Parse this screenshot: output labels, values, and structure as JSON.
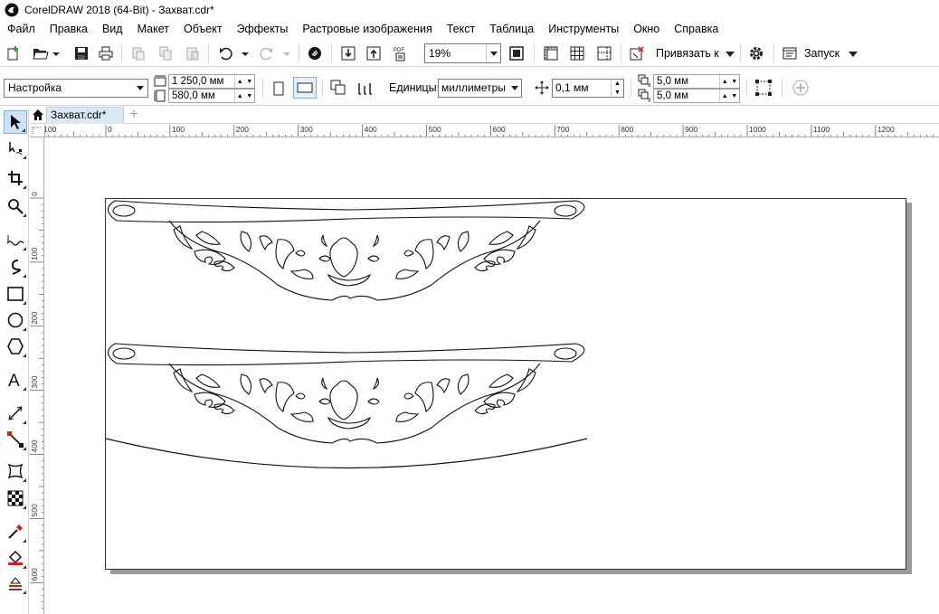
{
  "window": {
    "title": "CorelDRAW 2018 (64-Bit) - Захват.cdr*"
  },
  "menu": {
    "items": [
      "Файл",
      "Правка",
      "Вид",
      "Макет",
      "Объект",
      "Эффекты",
      "Растровые изображения",
      "Текст",
      "Таблица",
      "Инструменты",
      "Окно",
      "Справка"
    ]
  },
  "toolbar": {
    "zoom_value": "19%",
    "snap_label": "Привязать к",
    "launch_label": "Запуск"
  },
  "property_bar": {
    "preset": "Настройка",
    "width": "1 250,0 мм",
    "height": "580,0 мм",
    "units_label": "Единицы:",
    "units_value": "миллиметры",
    "nudge": "0,1 мм",
    "dup_x": "5,0 мм",
    "dup_y": "5,0 мм"
  },
  "document_tab": {
    "label": "Захват.cdr*"
  },
  "ruler": {
    "top_labels": [
      "100",
      "0",
      "100",
      "200",
      "300",
      "400",
      "500",
      "600",
      "700",
      "800",
      "900",
      "1000",
      "1100",
      "1200",
      "13"
    ],
    "left_labels": [
      "0",
      "100",
      "200",
      "300",
      "400",
      "500",
      "600"
    ]
  },
  "icons": {
    "app": "coreldraw-logo-icon",
    "tools": [
      "pick-tool-icon",
      "shape-tool-icon",
      "crop-tool-icon",
      "zoom-tool-icon",
      "freehand-tool-icon",
      "artistic-media-icon",
      "rectangle-tool-icon",
      "ellipse-tool-icon",
      "polygon-tool-icon",
      "text-tool-icon",
      "dimension-tool-icon",
      "connector-tool-icon",
      "envelope-tool-icon",
      "transparency-tool-icon",
      "eyedropper-tool-icon",
      "interactive-fill-icon",
      "smart-fill-icon"
    ]
  },
  "colors": {
    "active_tab": "#dde8f5",
    "active_tool": "#cfe3f7",
    "page_shadow": "#9b9b9b"
  }
}
